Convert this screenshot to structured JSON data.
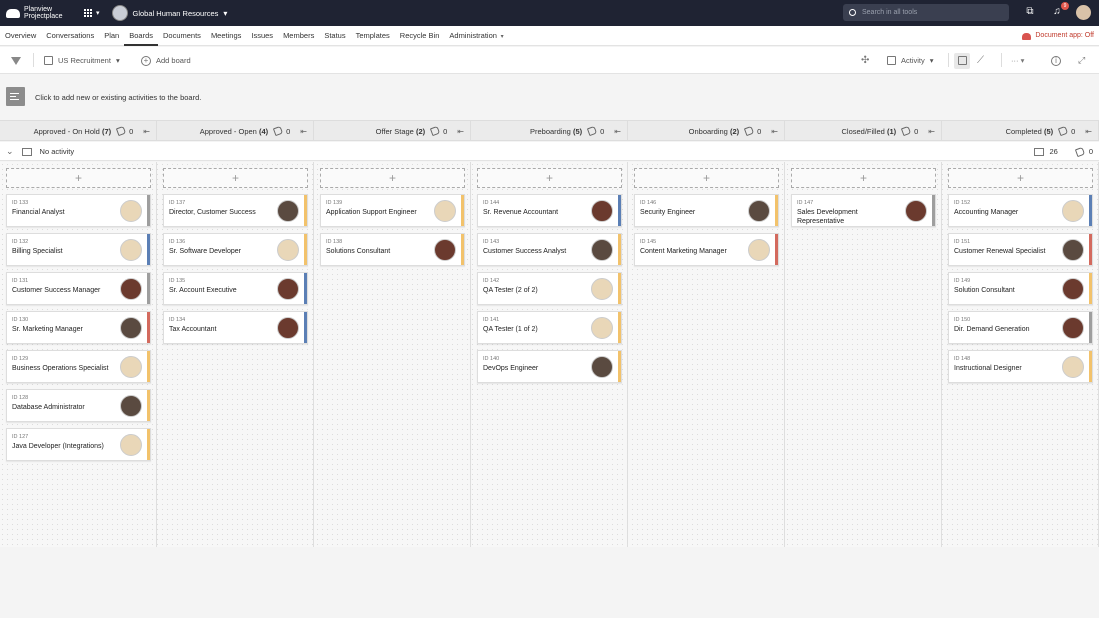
{
  "topbar": {
    "logo_text": "Planview\nProjectplace",
    "workspace": "Global Human Resources",
    "search_placeholder": "Search in all tools",
    "notification_count": "9"
  },
  "nav": {
    "items": [
      "Overview",
      "Conversations",
      "Plan",
      "Boards",
      "Documents",
      "Meetings",
      "Issues",
      "Members",
      "Status",
      "Templates",
      "Recycle Bin",
      "Administration"
    ],
    "active": "Boards",
    "document_app": "Document app: Off"
  },
  "toolbar": {
    "board": "US Recruitment",
    "add_board": "Add board",
    "activity": "Activity"
  },
  "add_strip": {
    "text": "Click to add new or existing activities to the board."
  },
  "columns": [
    {
      "title": "Approved - On Hold",
      "count": "(7)",
      "tags": "0"
    },
    {
      "title": "Approved - Open",
      "count": "(4)",
      "tags": "0"
    },
    {
      "title": "Offer Stage",
      "count": "(2)",
      "tags": "0"
    },
    {
      "title": "Preboarding",
      "count": "(5)",
      "tags": "0"
    },
    {
      "title": "Onboarding",
      "count": "(2)",
      "tags": "0"
    },
    {
      "title": "Closed/Filled",
      "count": "(1)",
      "tags": "0"
    },
    {
      "title": "Completed",
      "count": "(5)",
      "tags": "0"
    }
  ],
  "lane": {
    "label": "No activity",
    "cards_total": "26",
    "tags_total": "0"
  },
  "colors": {
    "gray": "#9e9e9e",
    "yellow": "#f2c26b",
    "blue": "#5b7fb5",
    "red": "#d36a5e"
  },
  "cards": [
    [
      {
        "id": "ID 133",
        "title": "Financial Analyst",
        "bar": "gray",
        "avatar": "#e9d7b8"
      },
      {
        "id": "ID 132",
        "title": "Billing Specialist",
        "bar": "blue",
        "avatar": "#e9d7b8"
      },
      {
        "id": "ID 131",
        "title": "Customer Success Manager",
        "bar": "gray",
        "avatar": "#6b3a2e"
      },
      {
        "id": "ID 130",
        "title": "Sr. Marketing Manager",
        "bar": "red",
        "avatar": "#5a4a40"
      },
      {
        "id": "ID 129",
        "title": "Business Operations Specialist",
        "bar": "yellow",
        "avatar": "#e9d7b8"
      },
      {
        "id": "ID 128",
        "title": "Database Administrator",
        "bar": "yellow",
        "avatar": "#5a4a40"
      },
      {
        "id": "ID 127",
        "title": "Java Developer (Integrations)",
        "bar": "yellow",
        "avatar": "#e9d7b8"
      }
    ],
    [
      {
        "id": "ID 137",
        "title": "Director, Customer Success",
        "bar": "yellow",
        "avatar": "#5a4a40"
      },
      {
        "id": "ID 136",
        "title": "Sr. Software Developer",
        "bar": "yellow",
        "avatar": "#e9d7b8"
      },
      {
        "id": "ID 135",
        "title": "Sr. Account Executive",
        "bar": "blue",
        "avatar": "#6b3a2e"
      },
      {
        "id": "ID 134",
        "title": "Tax Accountant",
        "bar": "blue",
        "avatar": "#6b3a2e"
      }
    ],
    [
      {
        "id": "ID 139",
        "title": "Application Support Engineer",
        "bar": "yellow",
        "avatar": "#e9d7b8"
      },
      {
        "id": "ID 138",
        "title": "Solutions Consultant",
        "bar": "yellow",
        "avatar": "#6b3a2e"
      }
    ],
    [
      {
        "id": "ID 144",
        "title": "Sr. Revenue Accountant",
        "bar": "blue",
        "avatar": "#6b3a2e"
      },
      {
        "id": "ID 143",
        "title": "Customer Success Analyst",
        "bar": "yellow",
        "avatar": "#5a4a40"
      },
      {
        "id": "ID 142",
        "title": "QA Tester (2 of 2)",
        "bar": "yellow",
        "avatar": "#e9d7b8"
      },
      {
        "id": "ID 141",
        "title": "QA Tester (1 of 2)",
        "bar": "yellow",
        "avatar": "#e9d7b8"
      },
      {
        "id": "ID 140",
        "title": "DevOps Engineer",
        "bar": "yellow",
        "avatar": "#5a4a40"
      }
    ],
    [
      {
        "id": "ID 146",
        "title": "Security Engineer",
        "bar": "yellow",
        "avatar": "#5a4a40"
      },
      {
        "id": "ID 145",
        "title": "Content Marketing Manager",
        "bar": "red",
        "avatar": "#e9d7b8"
      }
    ],
    [
      {
        "id": "ID 147",
        "title": "Sales Development Representative",
        "bar": "gray",
        "avatar": "#6b3a2e"
      }
    ],
    [
      {
        "id": "ID 152",
        "title": "Accounting Manager",
        "bar": "blue",
        "avatar": "#e9d7b8"
      },
      {
        "id": "ID 151",
        "title": "Customer Renewal Specialist",
        "bar": "red",
        "avatar": "#5a4a40"
      },
      {
        "id": "ID 149",
        "title": "Solution Consultant",
        "bar": "yellow",
        "avatar": "#6b3a2e"
      },
      {
        "id": "ID 150",
        "title": "Dir. Demand Generation",
        "bar": "gray",
        "avatar": "#6b3a2e"
      },
      {
        "id": "ID 148",
        "title": "Instructional Designer",
        "bar": "yellow",
        "avatar": "#e9d7b8"
      }
    ]
  ]
}
